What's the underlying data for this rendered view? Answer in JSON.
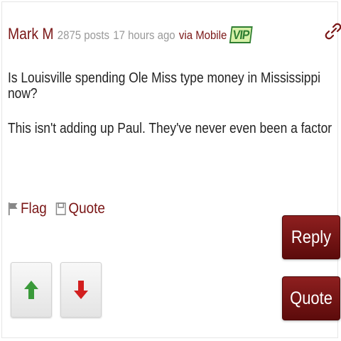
{
  "post": {
    "author": "Mark M",
    "posts": "2875 posts",
    "time": "17 hours ago",
    "via": "via Mobile",
    "badge": "VIP",
    "lines": [
      "Is Louisville spending Ole Miss type money in Mississippi now?",
      "This isn't adding up Paul. They've never even been a factor"
    ]
  },
  "actions": {
    "flag": "Flag",
    "quote": "Quote"
  },
  "buttons": {
    "reply": "Reply",
    "quote": "Quote"
  },
  "colors": {
    "accent": "#7a1616",
    "button": "#7d1717",
    "upvote": "#3a9a3a",
    "downvote": "#d21f1f",
    "badge_text": "#2e7d32",
    "badge_bg": "#d7f1a8"
  },
  "icons": {
    "permalink": "link-icon",
    "flag": "flag-icon",
    "quote": "quote-icon",
    "upvote": "arrow-up-icon",
    "downvote": "arrow-down-icon"
  }
}
